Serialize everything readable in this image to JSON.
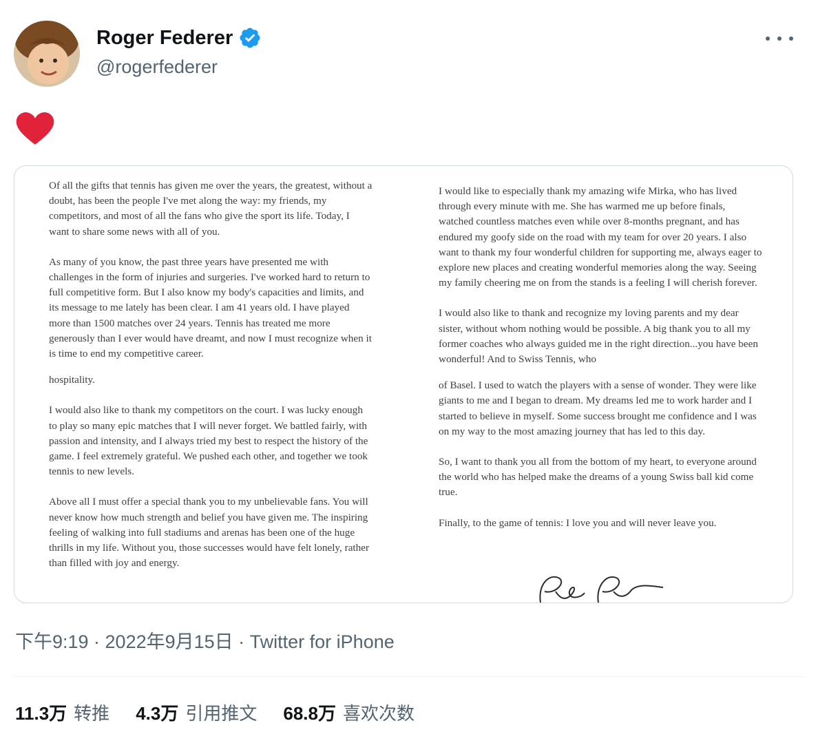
{
  "author": {
    "display_name": "Roger Federer",
    "handle": "@rogerfederer"
  },
  "tweet": {
    "emoji": "heart",
    "letter": {
      "left": [
        "Of all the gifts that tennis has given me over the years, the greatest, without a doubt, has been the people I've met along the way: my friends, my competitors, and most of all the fans who give the sport its life. Today, I want to share some news with all of you.",
        "As many of you know, the past three years have presented me with challenges in the form of injuries and surgeries. I've worked hard to return to full competitive form. But I also know my body's capacities and limits, and its message to me lately has been clear. I am 41 years old. I have played more than 1500 matches over 24 years. Tennis has treated me more generously than I ever would have dreamt, and now I must recognize when it is time to end my competitive career.",
        "hospitality.",
        "I would also like to thank my competitors on the court. I was lucky enough to play so many epic matches that I will never forget. We battled fairly, with passion and intensity, and I always tried my best to respect the history of the game. I feel extremely grateful. We pushed each other, and together we took tennis to new levels.",
        "Above all I must offer a special thank you to my unbelievable fans. You will never know how much strength and belief you have given me. The inspiring feeling of walking into full stadiums and arenas has been one of the huge thrills in my life. Without you, those successes would have felt lonely, rather than filled with joy and energy."
      ],
      "right": [
        "I would like to especially thank my amazing wife Mirka, who has lived through every minute with me. She has warmed me up before finals, watched countless matches even while over 8-months pregnant, and has endured my goofy side on the road with my team for over 20 years. I also want to thank my four wonderful children for supporting me, always eager to explore new places and creating wonderful memories along the way. Seeing my family cheering me on from the stands is a feeling I will cherish forever.",
        "I would also like to thank and recognize my loving parents and my dear sister, without whom nothing would be possible. A big thank you to all my former coaches who always guided me in the right direction...you have been wonderful! And to Swiss Tennis, who",
        "of Basel. I used to watch the players with a sense of wonder. They were like giants to me and I began to dream. My dreams led me to work harder and I started to believe in myself. Some success brought me confidence and I was on my way to the most amazing journey that has led to this day.",
        "So, I want to thank you all from the bottom of my heart, to everyone around the world who has helped make the dreams of a young Swiss ball kid come true.",
        "Finally, to the game of tennis: I love you and will never leave you."
      ]
    },
    "meta": "下午9:19 · 2022年9月15日 · Twitter for iPhone"
  },
  "stats": [
    {
      "count": "11.3万",
      "label": "转推"
    },
    {
      "count": "4.3万",
      "label": "引用推文"
    },
    {
      "count": "68.8万",
      "label": "喜欢次数"
    }
  ],
  "colors": {
    "verified": "#1d9bf0",
    "heart": "#e0223a",
    "secondary_text": "#536471"
  }
}
